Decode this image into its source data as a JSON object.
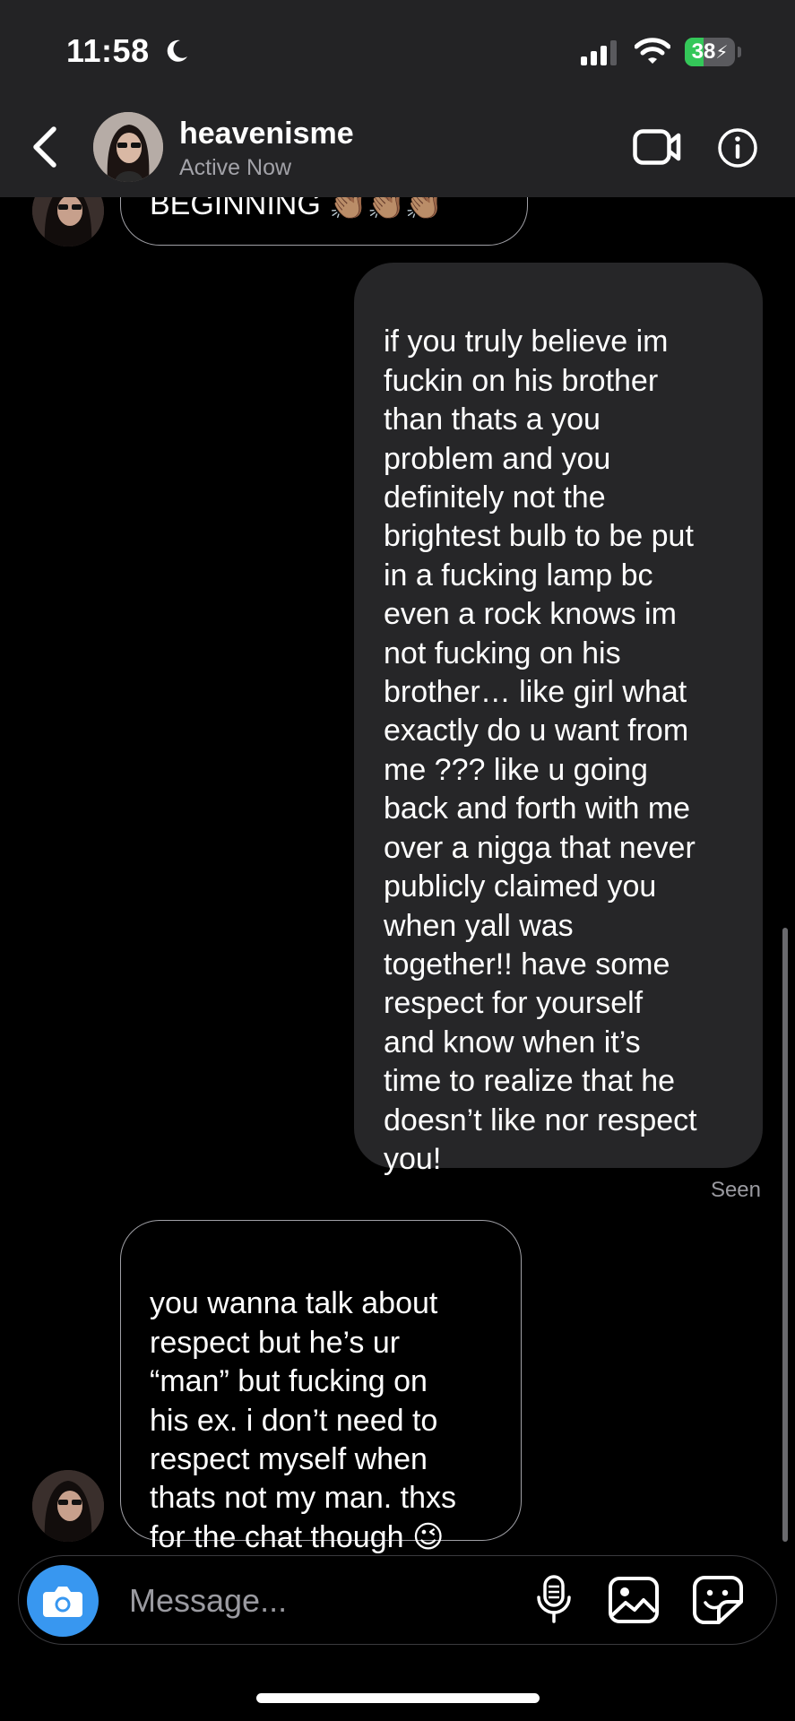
{
  "status_bar": {
    "time": "11:58",
    "battery_percent": "38",
    "battery_level": 0.38,
    "icons": [
      "moon-icon",
      "signal-bars-icon",
      "wifi-icon",
      "battery-charging-icon"
    ]
  },
  "header": {
    "username": "heavenisme",
    "status": "Active Now",
    "icons": [
      "back-chevron-icon",
      "video-call-icon",
      "info-icon"
    ]
  },
  "colors": {
    "header_bg": "#232325",
    "outgoing_bubble": "#262628",
    "incoming_border": "#a0a0a6",
    "camera_accent": "#3897f0",
    "battery_green": "#34c759"
  },
  "messages": [
    {
      "direction": "incoming",
      "text": "BEGINNING 👏🏽👏🏽👏🏽"
    },
    {
      "direction": "outgoing",
      "text": "if you truly believe im\nfuckin on his brother\nthan thats a you\nproblem and you\ndefinitely not the\nbrightest bulb to be put\nin a fucking lamp bc\neven a rock knows im\nnot fucking on his\nbrother… like girl what\nexactly do u want from\nme ??? like u going\nback and forth with me\nover a nigga that never\npublicly claimed you\nwhen yall was\ntogether!! have some\nrespect for yourself\nand know when it’s\ntime to realize that he\ndoesn’t like nor respect\nyou!",
      "receipt": "Seen"
    },
    {
      "direction": "incoming",
      "text": "you wanna talk about\nrespect but he’s ur\n“man” but fucking on\nhis ex. i don’t need to\nrespect myself when\nthats not my man. thxs\nfor the chat though",
      "emoji": "😉"
    }
  ],
  "composer": {
    "placeholder": "Message...",
    "icons": [
      "camera-icon",
      "microphone-icon",
      "gallery-icon",
      "sticker-icon"
    ]
  }
}
